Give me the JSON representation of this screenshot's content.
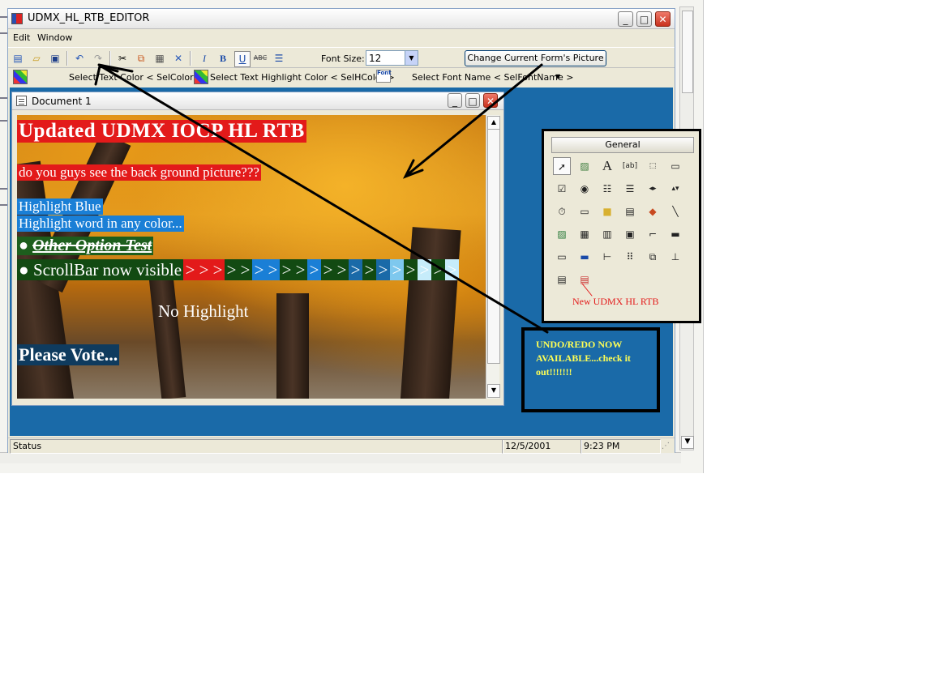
{
  "app": {
    "title": "UDMX_HL_RTB_EDITOR",
    "menu": [
      "Edit",
      "Window"
    ]
  },
  "toolbar": {
    "icons": [
      "new-icon",
      "open-icon",
      "save-icon",
      "undo-icon",
      "redo-icon",
      "cut-icon",
      "copy-icon",
      "paste-icon",
      "delete-icon",
      "italic-icon",
      "bold-icon",
      "underline-icon",
      "strikethrough-icon",
      "bullets-icon"
    ],
    "font_size_label": "Font Size:",
    "font_size_value": "12",
    "change_picture_label": "Change Current Form's Picture"
  },
  "format_bar": {
    "text_color_label": "Select Text Color < SelColor >",
    "highlight_color_label": "Select Text Highlight Color < SelHColor >",
    "font_name_label": "Select Font Name < SelFontName >",
    "font_icon_text": "Font"
  },
  "document": {
    "title": "Document 1",
    "lines": {
      "heading": "Updated UDMX IOCP HL RTB",
      "question": "do you guys see the back ground picture???",
      "highlight_blue": "Highlight Blue",
      "highlight_any": "Highlight word in any color...",
      "bullet": "●",
      "option_test": "Other Option Test",
      "scrollbar_text": "ScrollBar now visible",
      "chevron": ">",
      "no_highlight": "No Highlight",
      "vote": "Please Vote..."
    },
    "chevron_colors": [
      "#e31a1a",
      "#e31a1a",
      "#e31a1a",
      "#124a12",
      "#124a12",
      "#1a7fd6",
      "#1a7fd6",
      "#124a12",
      "#124a12",
      "#1a7fd6",
      "#124a12",
      "#124a12",
      "#1a6aa8",
      "#124a12",
      "#1a6aa8",
      "#7ec8ee",
      "#124a12",
      "#c6ecfa",
      "#124a12",
      "#c6ecfa"
    ]
  },
  "statusbar": {
    "status": "Status",
    "date": "12/5/2001",
    "time": "9:23 PM"
  },
  "toolbox": {
    "tab_label": "General",
    "new_control_label": "New UDMX HL RTB"
  },
  "note": {
    "text": "UNDO/REDO NOW AVAILABLE...check it out!!!!!!!"
  }
}
